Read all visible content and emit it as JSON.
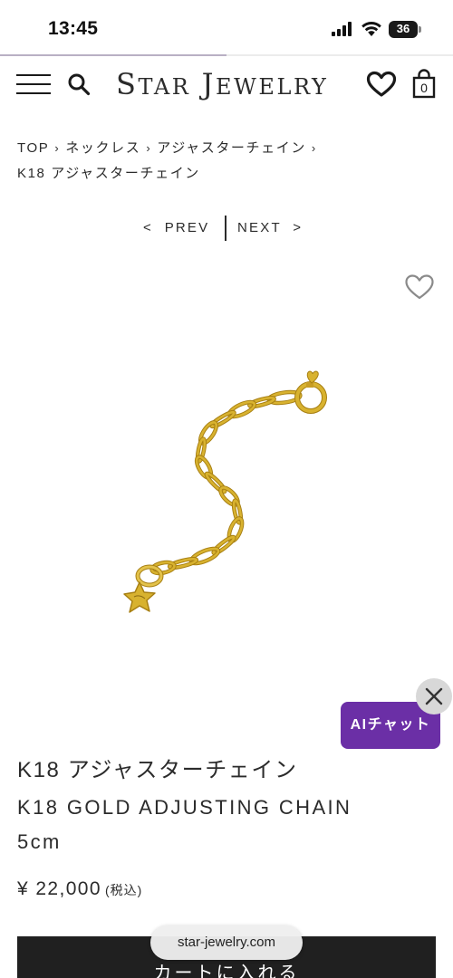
{
  "status_bar": {
    "time": "13:45",
    "battery": "36",
    "page_load_progress": 0.5
  },
  "header": {
    "logo": {
      "first_initial": "S",
      "first_rest": "TAR",
      "second_initial": "J",
      "second_rest": "EWELRY"
    },
    "cart_count": "0",
    "icons": [
      "menu-icon",
      "search-icon",
      "heart-icon",
      "shopping-bag-icon"
    ]
  },
  "breadcrumb": {
    "items": [
      "TOP",
      "ネックレス",
      "アジャスターチェイン",
      "K18 アジャスターチェイン"
    ],
    "separator": "›"
  },
  "pager": {
    "prev": "<  PREV",
    "next": "NEXT  >"
  },
  "product": {
    "name_jp": "K18 アジャスターチェイン",
    "name_en_line1": "K18 GOLD ADJUSTING CHAIN",
    "name_en_line2": "5cm",
    "price": "¥ 22,000",
    "price_tax_note": "(税込)",
    "image_colors": {
      "gold": "#d8b22f",
      "gold_dark": "#a77f12"
    }
  },
  "ai_chat": {
    "label": "AIチャット",
    "color": "#6b2fa6",
    "close_icon": "close-icon"
  },
  "footer": {
    "add_to_cart": "カートに入れる",
    "url": "star-jewelry.com"
  }
}
